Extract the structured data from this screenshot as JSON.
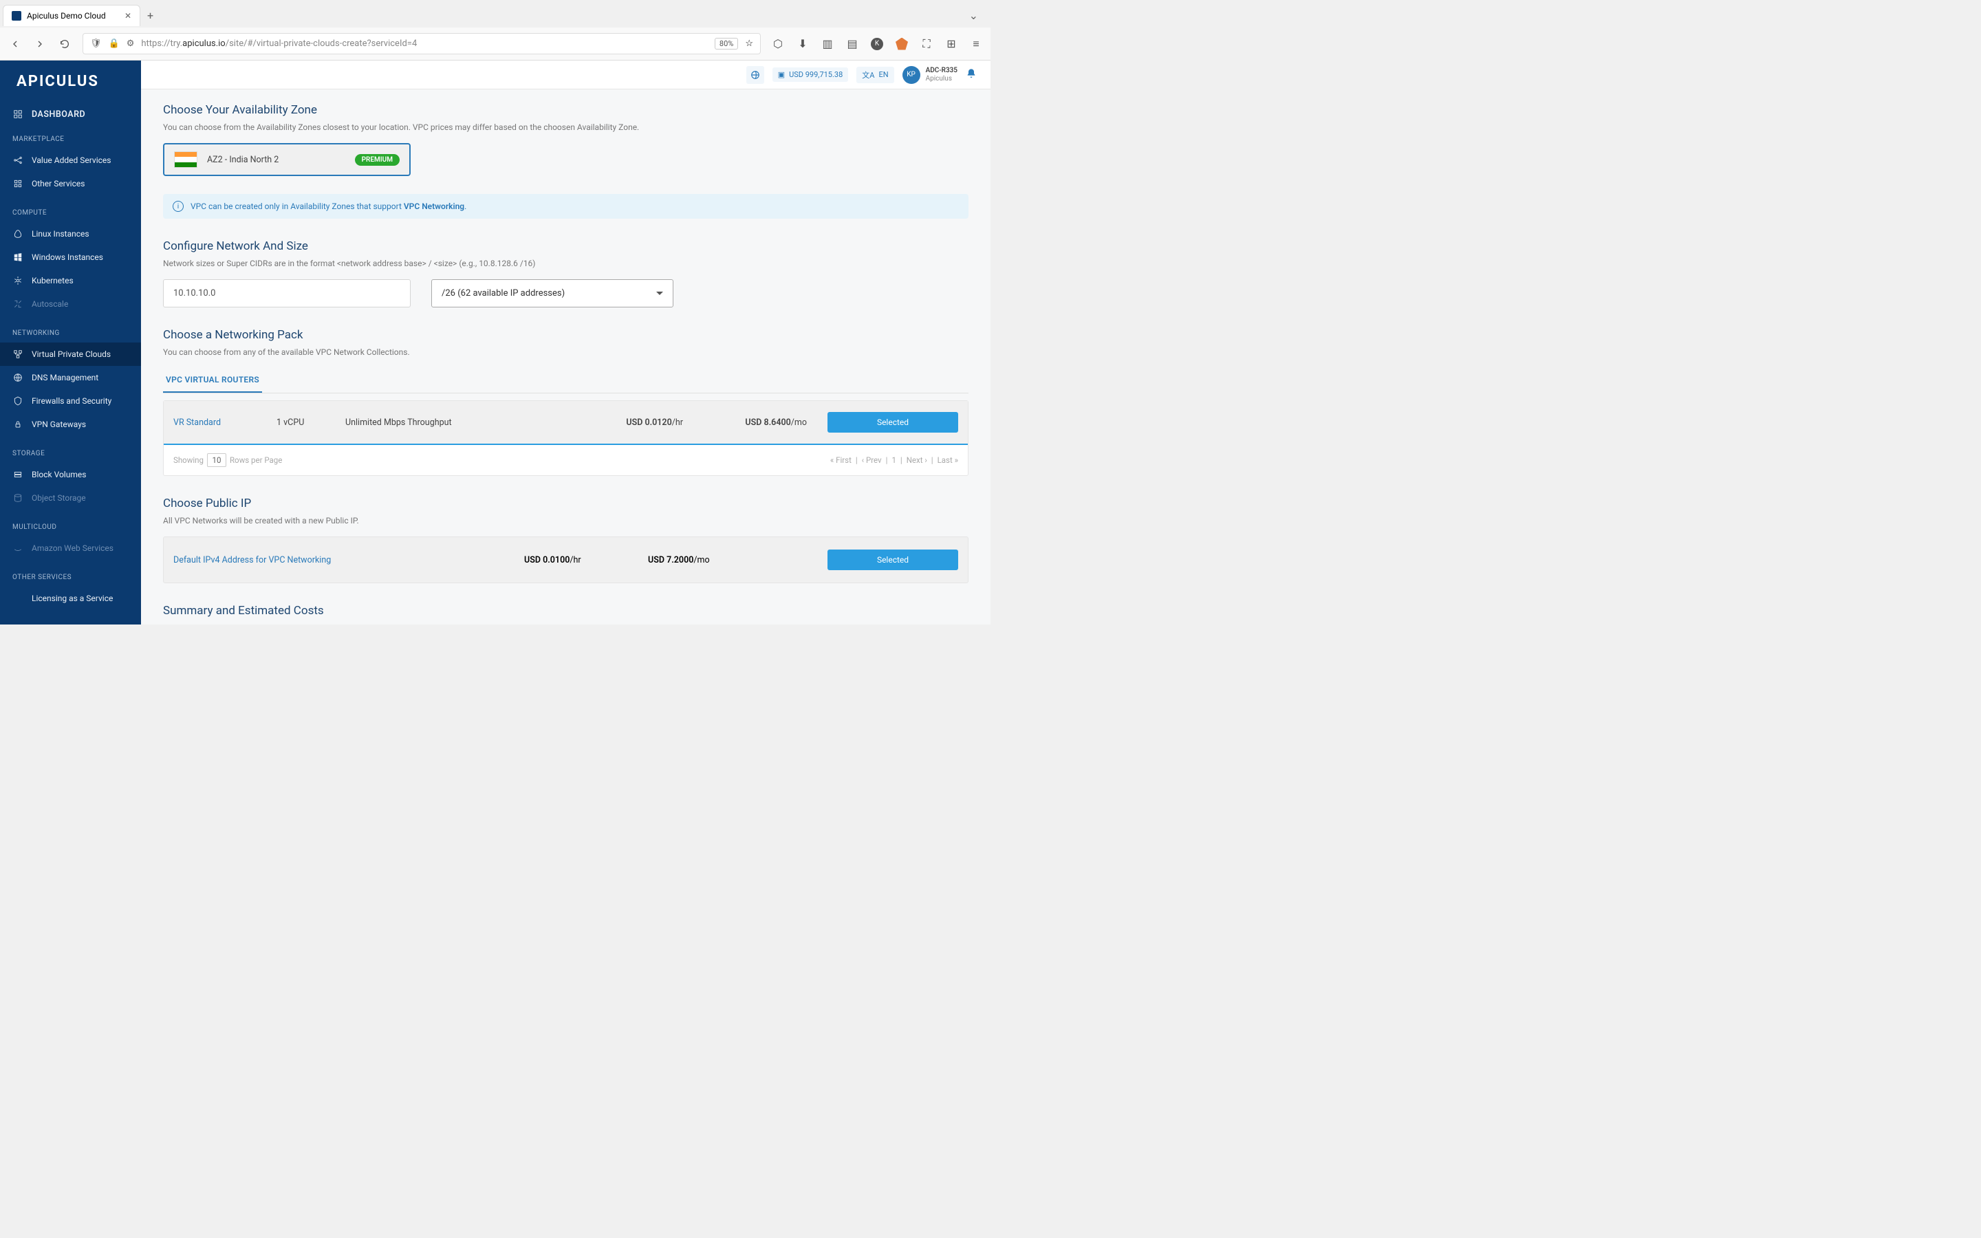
{
  "browser": {
    "tab_title": "Apiculus Demo Cloud",
    "url_prefix": "https://try.",
    "url_host": "apiculus.io",
    "url_path": "/site/#/virtual-private-clouds-create?serviceId=4",
    "zoom": "80%"
  },
  "logo": "APICULUS",
  "sidebar": {
    "dashboard": "DASHBOARD",
    "sections": {
      "marketplace": {
        "heading": "MARKETPLACE",
        "items": [
          "Value Added Services",
          "Other Services"
        ]
      },
      "compute": {
        "heading": "COMPUTE",
        "items": [
          "Linux Instances",
          "Windows Instances",
          "Kubernetes",
          "Autoscale"
        ]
      },
      "networking": {
        "heading": "NETWORKING",
        "items": [
          "Virtual Private Clouds",
          "DNS Management",
          "Firewalls and Security",
          "VPN Gateways"
        ]
      },
      "storage": {
        "heading": "STORAGE",
        "items": [
          "Block Volumes",
          "Object Storage"
        ]
      },
      "multicloud": {
        "heading": "MULTICLOUD",
        "items": [
          "Amazon Web Services"
        ]
      },
      "other": {
        "heading": "OTHER SERVICES",
        "items": [
          "Licensing as a Service"
        ]
      }
    }
  },
  "topbar": {
    "balance": "USD 999,715.38",
    "lang": "EN",
    "avatar": "KP",
    "user_id": "ADC-R335",
    "org": "Apiculus"
  },
  "az": {
    "title": "Choose Your Availability Zone",
    "sub": "You can choose from the Availability Zones closest to your location. VPC prices may differ based on the choosen Availability Zone.",
    "name": "AZ2 - India North 2",
    "badge": "PREMIUM",
    "info_pre": "VPC can be created only in Availability Zones that support ",
    "info_strong": "VPC Networking"
  },
  "net": {
    "title": "Configure Network And Size",
    "sub": "Network sizes or Super CIDRs are in the format <network address base> / <size> (e.g., 10.8.128.6 /16)",
    "ip_value": "10.10.10.0",
    "size_value": "/26 (62 available IP addresses)"
  },
  "pack": {
    "title": "Choose a Networking Pack",
    "sub": "You can choose from any of the available VPC Network Collections.",
    "tab": "VPC VIRTUAL ROUTERS",
    "row": {
      "name": "VR Standard",
      "cpu": "1 vCPU",
      "thr": "Unlimited Mbps Throughput",
      "hr_b": "USD 0.0120",
      "hr_s": "/hr",
      "mo_b": "USD 8.6400",
      "mo_s": "/mo",
      "btn": "Selected"
    },
    "pager": {
      "showing": "Showing",
      "rows": "10",
      "rpp": "Rows per Page",
      "first": "« First",
      "prev": "‹ Prev",
      "page": "1",
      "next": "Next ›",
      "last": "Last »"
    }
  },
  "ip": {
    "title": "Choose Public IP",
    "sub": "All VPC Networks will be created with a new Public IP.",
    "name": "Default IPv4 Address for VPC Networking",
    "hr_b": "USD 0.0100",
    "hr_s": "/hr",
    "mo_b": "USD 7.2000",
    "mo_s": "/mo",
    "btn": "Selected"
  },
  "summary": {
    "title": "Summary and Estimated Costs"
  }
}
